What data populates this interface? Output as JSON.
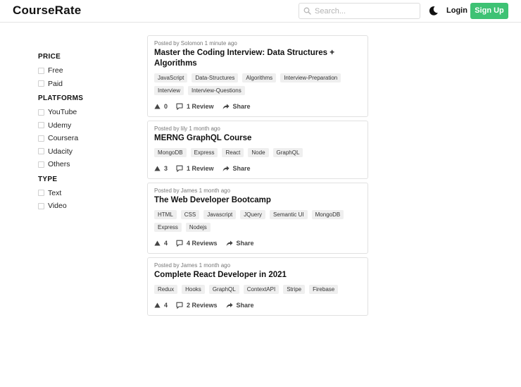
{
  "header": {
    "logo": "CourseRate",
    "search_placeholder": "Search...",
    "login_label": "Login",
    "signup_label": "Sign Up",
    "brand_color": "#3ec274"
  },
  "filters": [
    {
      "title": "PRICE",
      "options": [
        "Free",
        "Paid"
      ]
    },
    {
      "title": "PLATFORMS",
      "options": [
        "YouTube",
        "Udemy",
        "Coursera",
        "Udacity",
        "Others"
      ]
    },
    {
      "title": "TYPE",
      "options": [
        "Text",
        "Video"
      ]
    }
  ],
  "courses": [
    {
      "meta": "Posted by Solomon 1 minute ago",
      "title": "Master the Coding Interview: Data Structures + Algorithms",
      "tags": [
        "JavaScript",
        "Data-Structures",
        "Algorithms",
        "Interview-Preparation",
        "Interview",
        "Interview-Questions"
      ],
      "votes": "0",
      "reviews": "1 Review",
      "share": "Share"
    },
    {
      "meta": "Posted by lily 1 month ago",
      "title": "MERNG GraphQL Course",
      "tags": [
        "MongoDB",
        "Express",
        "React",
        "Node",
        "GraphQL"
      ],
      "votes": "3",
      "reviews": "1 Review",
      "share": "Share"
    },
    {
      "meta": "Posted by James 1 month ago",
      "title": "The Web Developer Bootcamp",
      "tags": [
        "HTML",
        "CSS",
        "Javascript",
        "JQuery",
        "Semantic UI",
        "MongoDB",
        "Express",
        "Nodejs"
      ],
      "votes": "4",
      "reviews": "4 Reviews",
      "share": "Share"
    },
    {
      "meta": "Posted by James 1 month ago",
      "title": "Complete React Developer in 2021",
      "tags": [
        "Redux",
        "Hooks",
        "GraphQL",
        "ContextAPI",
        "Stripe",
        "Firebase"
      ],
      "votes": "4",
      "reviews": "2 Reviews",
      "share": "Share"
    }
  ]
}
